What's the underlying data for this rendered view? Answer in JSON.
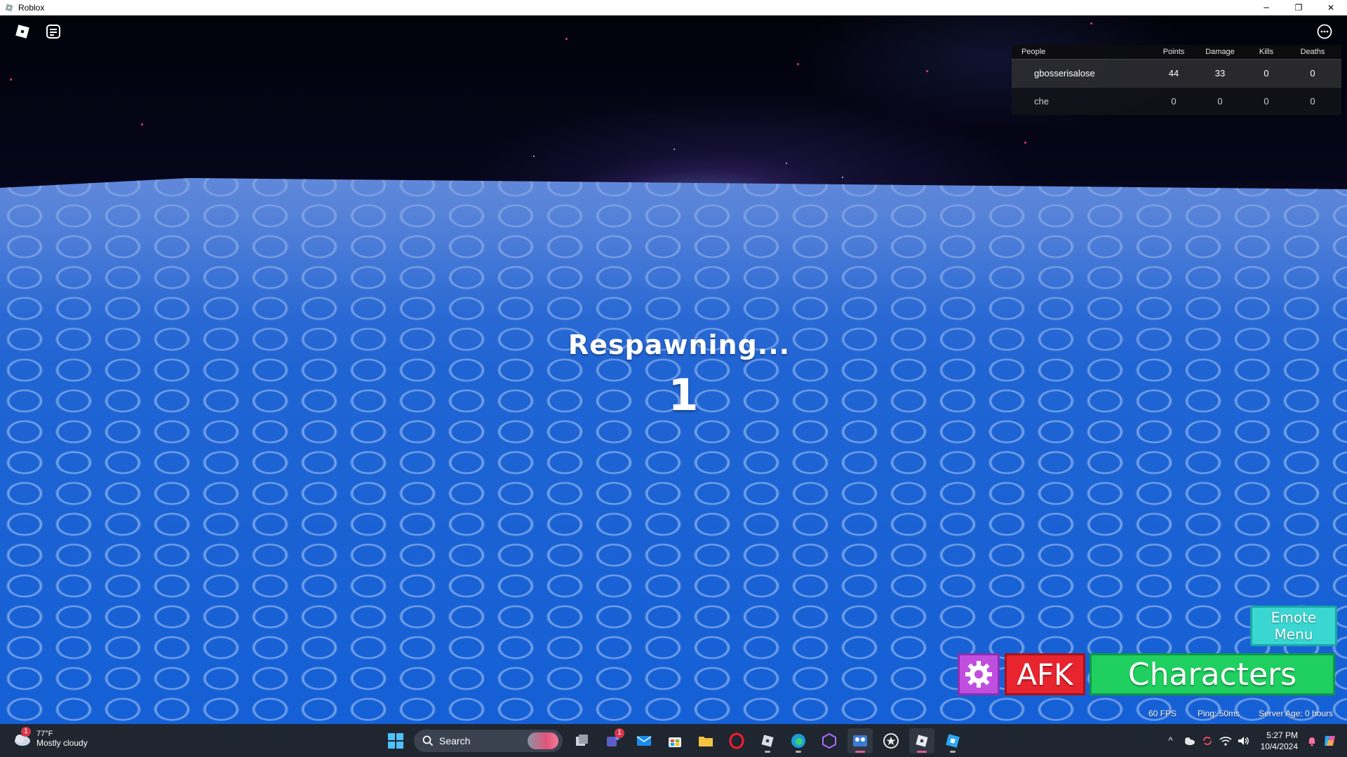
{
  "window": {
    "title": "Roblox",
    "controls": {
      "minimize": "─",
      "restore": "❐",
      "close": "✕"
    }
  },
  "leaderboard": {
    "headers": [
      "People",
      "Points",
      "Damage",
      "Kills",
      "Deaths"
    ],
    "rows": [
      {
        "name": "gbosserisalose",
        "points": "44",
        "damage": "33",
        "kills": "0",
        "deaths": "0"
      },
      {
        "name": "che",
        "points": "0",
        "damage": "0",
        "kills": "0",
        "deaths": "0"
      }
    ]
  },
  "respawn": {
    "label": "Respawning...",
    "countdown": "1"
  },
  "buttons": {
    "emote_line1": "Emote",
    "emote_line2": "Menu",
    "afk": "AFK",
    "characters": "Characters"
  },
  "stats": {
    "fps": "60 FPS",
    "ping": "Ping: 50ms",
    "server_age": "Server Age: 0 hours"
  },
  "taskbar": {
    "weather_temp": "77°F",
    "weather_condition": "Mostly cloudy",
    "weather_badge": "1",
    "search_placeholder": "Search",
    "teams_badge": "1",
    "time": "5:27 PM",
    "date": "10/4/2024"
  },
  "colors": {
    "afk": "#e8242e",
    "characters": "#1fd060",
    "emote": "#3ad6d2",
    "settings": "#c04fe0",
    "ocean": "#1560d6"
  }
}
